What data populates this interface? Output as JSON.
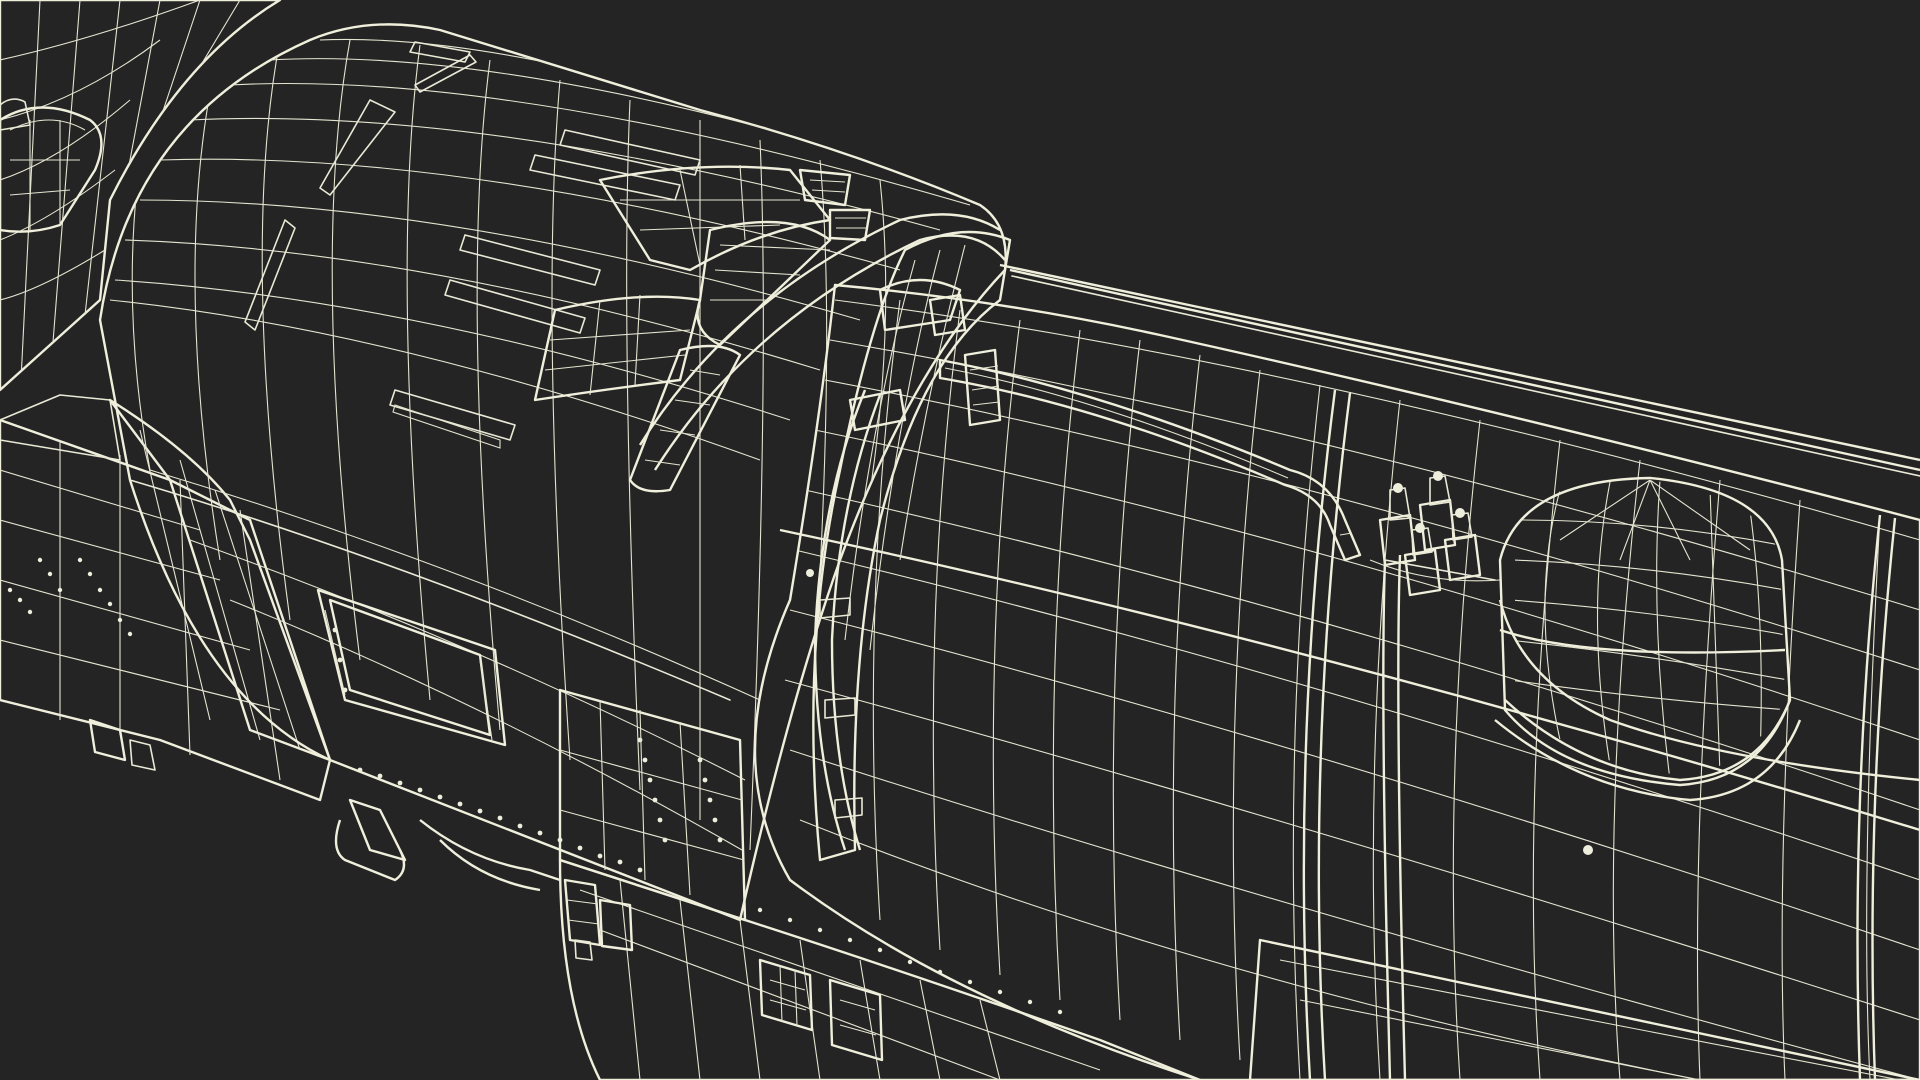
{
  "scene": {
    "background_color": "#242424",
    "surface_color": "#79796b",
    "surface_shadow_color": "#626256",
    "surface_light_color": "#8a8a7b",
    "wire_color": "#e9e9d6",
    "subject_icon": "steam-locomotive-wireframe-icon"
  }
}
